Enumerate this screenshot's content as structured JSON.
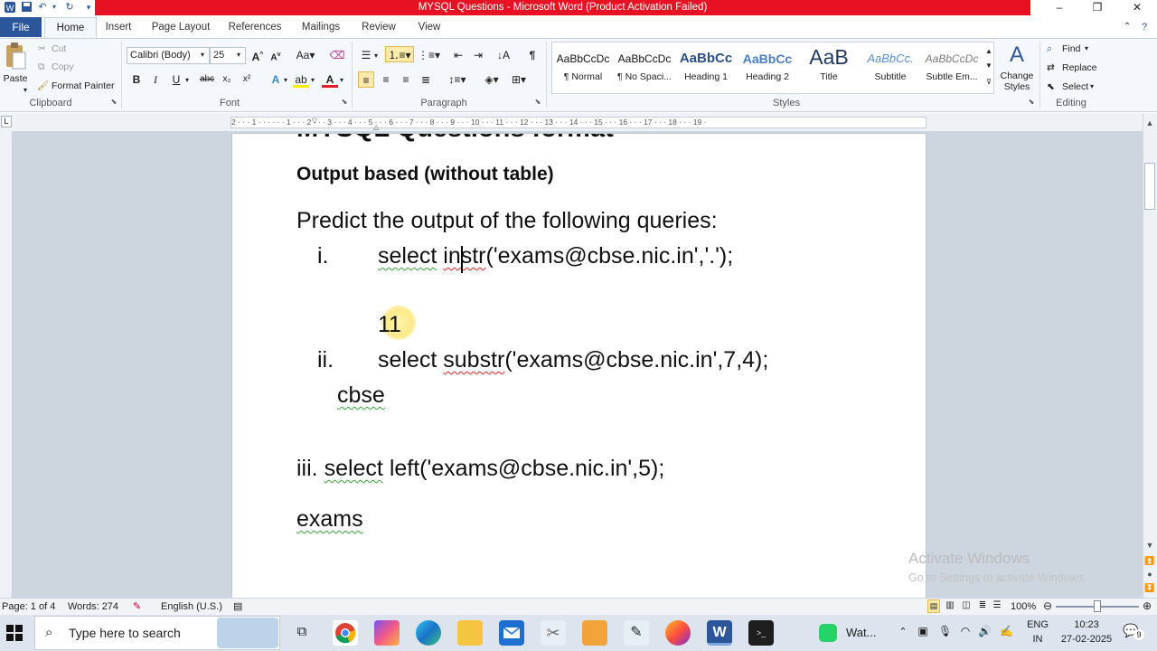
{
  "window": {
    "title": "MYSQL Questions - Microsoft Word (Product Activation Failed)",
    "qat": [
      "save-icon",
      "undo-icon",
      "repeat-icon",
      "customize-icon"
    ]
  },
  "tabs": [
    "File",
    "Home",
    "Insert",
    "Page Layout",
    "References",
    "Mailings",
    "Review",
    "View"
  ],
  "ribbon": {
    "clipboard": {
      "paste": "Paste",
      "cut": "Cut",
      "copy": "Copy",
      "format_painter": "Format Painter",
      "group": "Clipboard"
    },
    "font": {
      "name": "Calibri (Body)",
      "size": "25",
      "group": "Font"
    },
    "paragraph": {
      "group": "Paragraph"
    },
    "styles": {
      "items": [
        {
          "sample": "AaBbCcDc",
          "name": "¶ Normal"
        },
        {
          "sample": "AaBbCcDc",
          "name": "¶ No Spaci..."
        },
        {
          "sample": "AaBbCc",
          "name": "Heading 1"
        },
        {
          "sample": "AaBbCc",
          "name": "Heading 2"
        },
        {
          "sample": "AaB",
          "name": "Title"
        },
        {
          "sample": "AaBbCc.",
          "name": "Subtitle"
        },
        {
          "sample": "AaBbCcDc",
          "name": "Subtle Em..."
        }
      ],
      "change_styles": "Change Styles",
      "group": "Styles"
    },
    "editing": {
      "find": "Find",
      "replace": "Replace",
      "select": "Select",
      "group": "Editing"
    }
  },
  "ruler": {
    "marks": "2 · · · 1 · · · · · · 1 · · · 2 · · · 3 · · · 4 · · · 5 · · · 6 · · · 7 · · · 8 · · · 9 · · · 10 · · · 11 · · · 12 · · · 13 · · · 14 · · · 15 · · · 16 · · · 17 · · · 18 · · · 19 ·"
  },
  "document": {
    "top_heading_partial": "MYSQL Questions format",
    "subheading": "Output based (without table)",
    "prompt": "Predict the output of the following queries:",
    "q1_num": "i.",
    "q1_select": "select",
    "q1_fn": "instr",
    "q1_rest": "('exams@cbse.nic.in','.');",
    "a1": "11",
    "q2_num": "ii.",
    "q2_select": "select",
    "q2_fn": "substr",
    "q2_rest": "('exams@cbse.nic.in',7,4);",
    "a2": "cbse",
    "q3_num": "iii.",
    "q3_select": "select",
    "q3_rest": "left('exams@cbse.nic.in',5);",
    "a3": "exams"
  },
  "watermark": {
    "line1": "Activate Windows",
    "line2": "Go to Settings to activate Windows."
  },
  "status": {
    "page": "Page: 1 of 4",
    "words": "Words: 274",
    "language": "English (U.S.)",
    "zoom": "100%"
  },
  "taskbar": {
    "search_placeholder": "Type here to search",
    "whatsapp": "Wat...",
    "lang1": "ENG",
    "lang2": "IN",
    "time": "10:23",
    "date": "27-02-2025",
    "notifications": "9"
  },
  "colors": {
    "accent": "#2b579a",
    "titlebar_red": "#e81123",
    "ribbon_bg": "#f4f7fb"
  }
}
